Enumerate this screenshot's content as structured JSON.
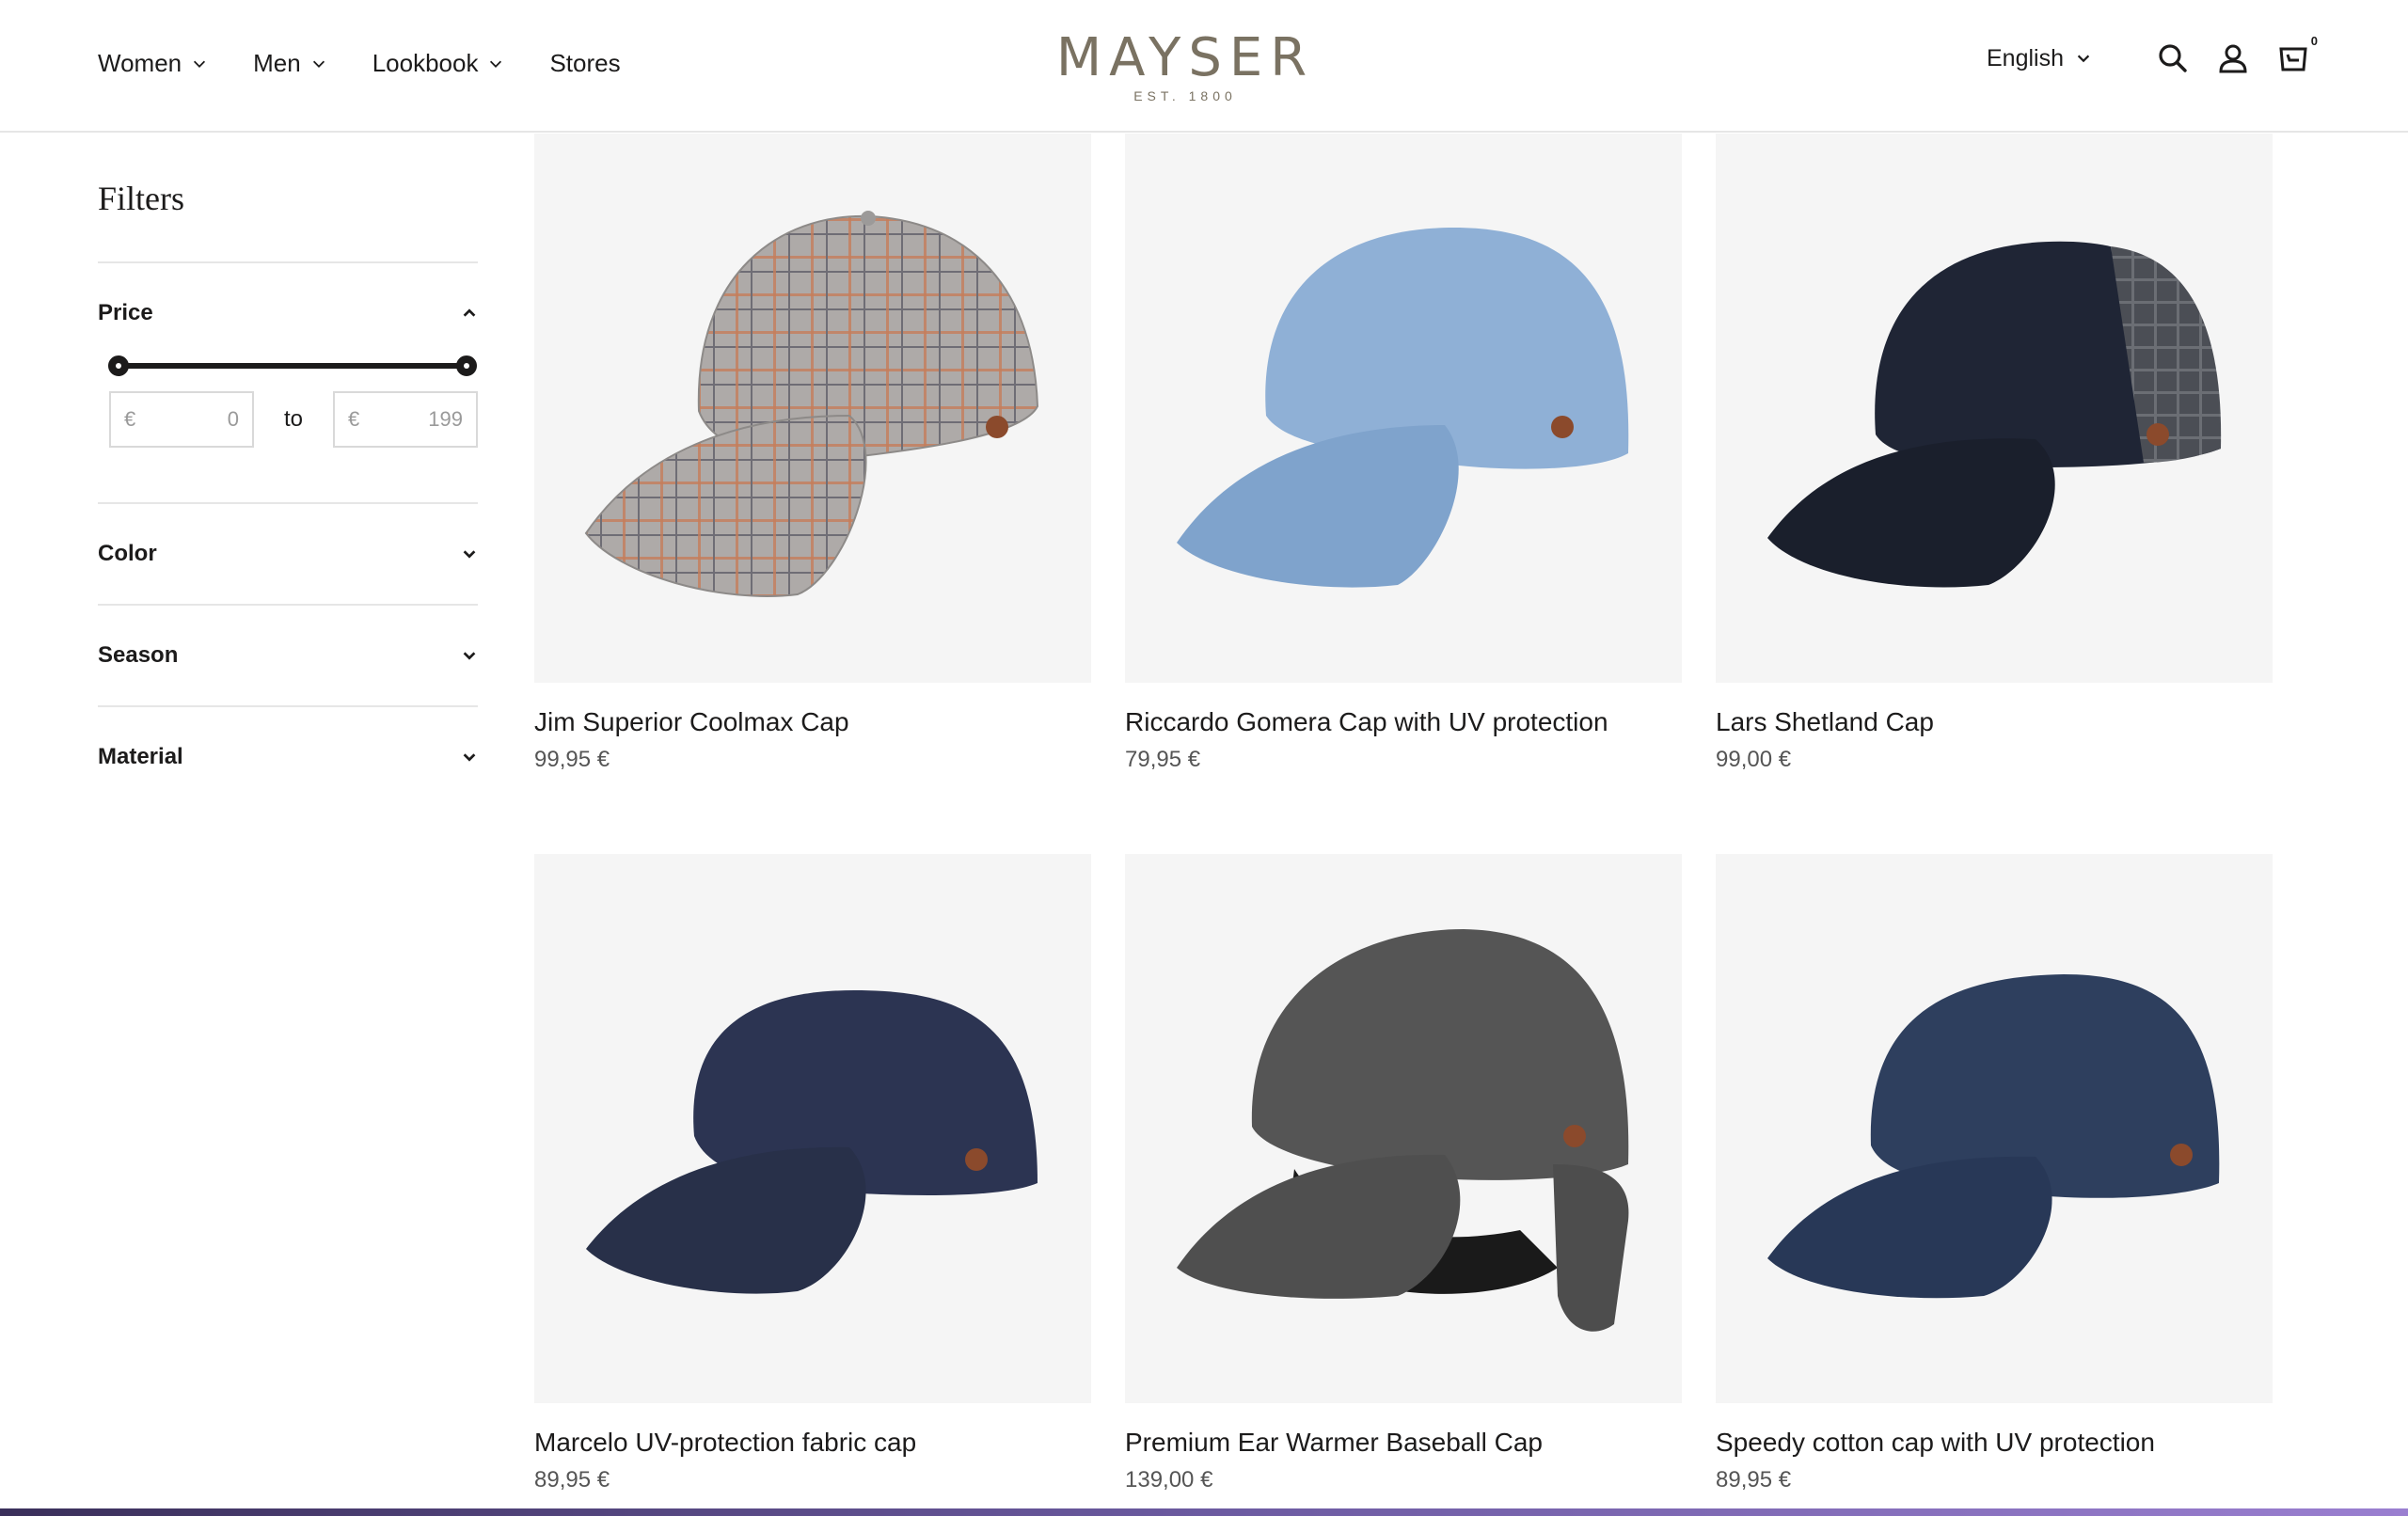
{
  "header": {
    "nav": [
      {
        "label": "Women",
        "has_menu": true
      },
      {
        "label": "Men",
        "has_menu": true
      },
      {
        "label": "Lookbook",
        "has_menu": true
      },
      {
        "label": "Stores",
        "has_menu": false
      }
    ],
    "logo": {
      "wordmark": "MAYSER",
      "tagline": "EST. 1800"
    },
    "language": "English",
    "cart_count": "0",
    "icons": [
      "search-icon",
      "account-icon",
      "cart-icon"
    ]
  },
  "filters": {
    "title": "Filters",
    "sections": [
      {
        "label": "Price",
        "expanded": true
      },
      {
        "label": "Color",
        "expanded": false
      },
      {
        "label": "Season",
        "expanded": false
      },
      {
        "label": "Material",
        "expanded": false
      }
    ],
    "price": {
      "currency": "€",
      "min_placeholder": "0",
      "max_placeholder": "199",
      "separator": "to",
      "range_min": 0,
      "range_max": 199
    }
  },
  "products": [
    {
      "name": "Jim Superior Coolmax Cap",
      "price": "99,95 €",
      "image": "plaid-grey-cap",
      "color": "#a9a7a8"
    },
    {
      "name": "Riccardo Gomera Cap with UV protection",
      "price": "79,95 €",
      "image": "light-blue-cap",
      "color": "#8fb0d6"
    },
    {
      "name": "Lars Shetland Cap",
      "price": "99,00 €",
      "image": "navy-check-cap",
      "color": "#1f2535"
    },
    {
      "name": "Marcelo UV-protection fabric cap",
      "price": "89,95 €",
      "image": "navy-cap",
      "color": "#2c3452"
    },
    {
      "name": "Premium Ear Warmer Baseball Cap",
      "price": "139,00 €",
      "image": "grey-earflap-cap",
      "color": "#555555"
    },
    {
      "name": "Speedy cotton cap with UV protection",
      "price": "89,95 €",
      "image": "denim-cap",
      "color": "#2e3f5e"
    }
  ],
  "colors": {
    "brand": "#7a7262",
    "text": "#1c1b1b",
    "card_bg": "#f5f5f5",
    "divider": "#e6e6e6"
  }
}
